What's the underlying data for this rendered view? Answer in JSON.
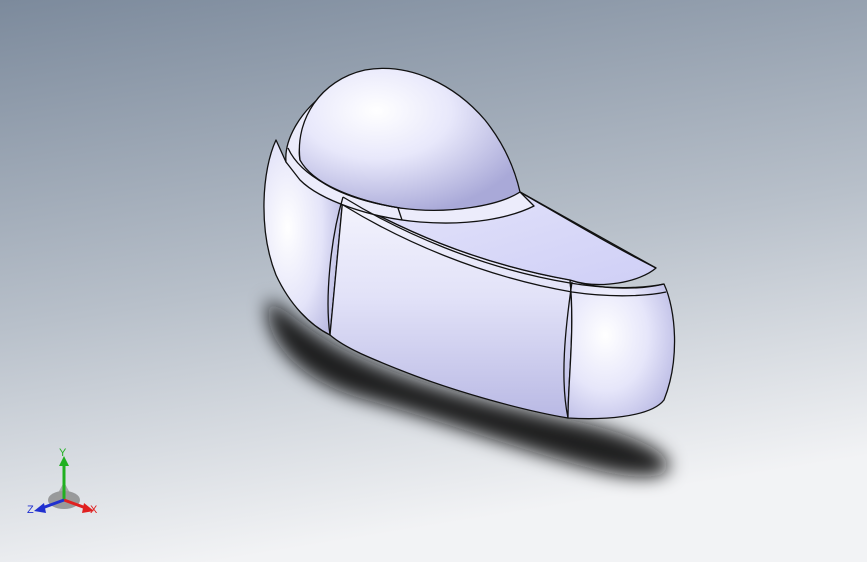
{
  "viewport": {
    "background_top": "#7e8b9d",
    "background_bottom": "#eef0f2",
    "model_color": "#dcdcf6",
    "edge_color": "#111111"
  },
  "triad": {
    "x_label": "X",
    "y_label": "Y",
    "z_label": "Z",
    "x_color": "#e02020",
    "y_color": "#20b020",
    "z_color": "#2030d0"
  }
}
